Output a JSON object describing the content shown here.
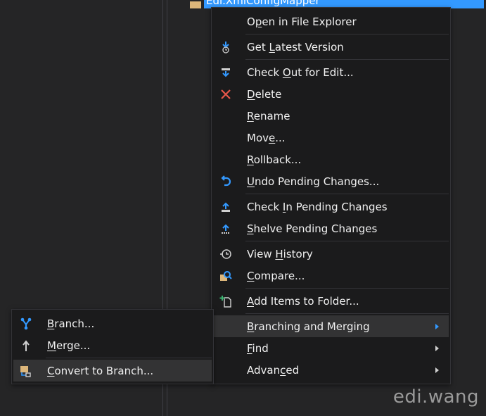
{
  "tree": {
    "node_label": "Edi.XmlConfigMapper"
  },
  "context_menu": {
    "groups": [
      [
        {
          "pre": "O",
          "u": "p",
          "post": "en in File Explorer",
          "icon": ""
        }
      ],
      [
        {
          "pre": "Get ",
          "u": "L",
          "post": "atest Version",
          "icon": "get-latest-icon"
        }
      ],
      [
        {
          "pre": "Check ",
          "u": "O",
          "post": "ut for Edit...",
          "icon": "check-out-icon"
        },
        {
          "pre": "",
          "u": "D",
          "post": "elete",
          "icon": "delete-icon"
        },
        {
          "pre": "",
          "u": "R",
          "post": "ename",
          "icon": ""
        },
        {
          "pre": "Mov",
          "u": "e",
          "post": "...",
          "icon": ""
        },
        {
          "pre": "",
          "u": "R",
          "post": "ollback...",
          "icon": ""
        },
        {
          "pre": "",
          "u": "U",
          "post": "ndo Pending Changes...",
          "icon": "undo-icon"
        }
      ],
      [
        {
          "pre": "Check ",
          "u": "I",
          "post": "n Pending Changes",
          "icon": "check-in-icon"
        },
        {
          "pre": "",
          "u": "S",
          "post": "helve Pending Changes",
          "icon": "shelve-icon"
        }
      ],
      [
        {
          "pre": "View ",
          "u": "H",
          "post": "istory",
          "icon": "history-icon"
        },
        {
          "pre": "",
          "u": "C",
          "post": "ompare...",
          "icon": "compare-icon"
        }
      ],
      [
        {
          "pre": "",
          "u": "A",
          "post": "dd Items to Folder...",
          "icon": "add-items-icon"
        }
      ],
      [
        {
          "pre": "",
          "u": "B",
          "post": "ranching and Merging",
          "icon": "",
          "submenu": true,
          "highlight": true
        },
        {
          "pre": "",
          "u": "F",
          "post": "ind",
          "icon": "",
          "submenu": true
        },
        {
          "pre": "Advan",
          "u": "c",
          "post": "ed",
          "icon": "",
          "submenu": true
        }
      ]
    ]
  },
  "submenu": {
    "groups": [
      [
        {
          "pre": "",
          "u": "B",
          "post": "ranch...",
          "icon": "branch-icon"
        },
        {
          "pre": "",
          "u": "M",
          "post": "erge...",
          "icon": "merge-icon"
        }
      ],
      [
        {
          "pre": "",
          "u": "C",
          "post": "onvert to Branch...",
          "icon": "convert-to-branch-icon",
          "highlight": true
        }
      ]
    ]
  },
  "watermark": "edi.wang",
  "colors": {
    "menu_bg": "#1b1b1c",
    "highlight": "#333334",
    "accent": "#3399ff",
    "delete": "#e8574a"
  }
}
